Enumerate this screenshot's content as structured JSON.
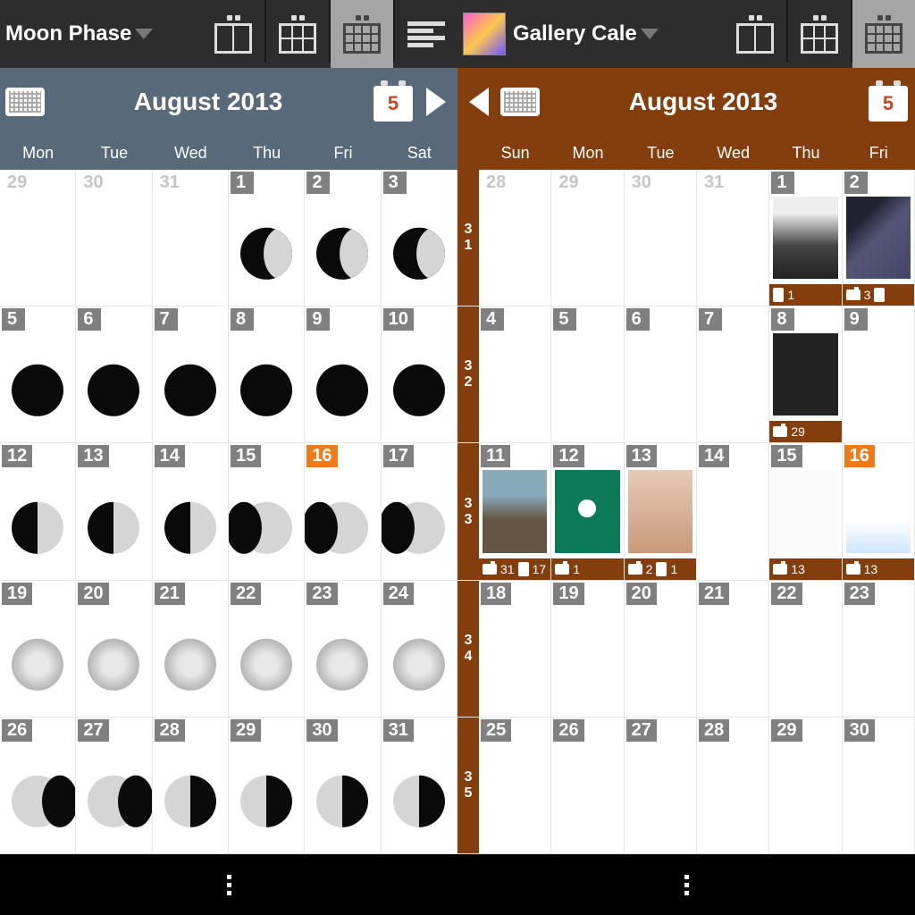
{
  "left": {
    "app_title": "Moon Phase",
    "month_title": "August 2013",
    "today_btn": "5",
    "daynames": [
      "Mon",
      "Tue",
      "Wed",
      "Thu",
      "Fri",
      "Sat"
    ],
    "weeks": [
      [
        {
          "n": "29",
          "o": 1
        },
        {
          "n": "30",
          "o": 1
        },
        {
          "n": "31",
          "o": 1
        },
        {
          "n": "1",
          "p": "wax-c"
        },
        {
          "n": "2",
          "p": "wax-c"
        },
        {
          "n": "3",
          "p": "wax-c"
        }
      ],
      [
        {
          "n": "5",
          "p": "new"
        },
        {
          "n": "6",
          "p": "new"
        },
        {
          "n": "7",
          "p": "new"
        },
        {
          "n": "8",
          "p": "new"
        },
        {
          "n": "9",
          "p": "new"
        },
        {
          "n": "10",
          "p": "new"
        }
      ],
      [
        {
          "n": "12",
          "p": "fq"
        },
        {
          "n": "13",
          "p": "fq"
        },
        {
          "n": "14",
          "p": "fq"
        },
        {
          "n": "15",
          "p": "wax-g"
        },
        {
          "n": "16",
          "p": "wax-g",
          "t": 1
        },
        {
          "n": "17",
          "p": "wax-g"
        }
      ],
      [
        {
          "n": "19",
          "p": "full"
        },
        {
          "n": "20",
          "p": "full"
        },
        {
          "n": "21",
          "p": "full"
        },
        {
          "n": "22",
          "p": "full"
        },
        {
          "n": "23",
          "p": "full"
        },
        {
          "n": "24",
          "p": "full"
        }
      ],
      [
        {
          "n": "26",
          "p": "wan-g"
        },
        {
          "n": "27",
          "p": "wan-g"
        },
        {
          "n": "28",
          "p": "lq"
        },
        {
          "n": "29",
          "p": "lq"
        },
        {
          "n": "30",
          "p": "lq"
        },
        {
          "n": "31",
          "p": "lq"
        }
      ]
    ]
  },
  "right": {
    "app_title": "Gallery Cale",
    "month_title": "August 2013",
    "today_btn": "5",
    "daynames": [
      "Sun",
      "Mon",
      "Tue",
      "Wed",
      "Thu",
      "Fri"
    ],
    "wknums": [
      "31",
      "32",
      "33",
      "34",
      "35"
    ],
    "weeks": [
      [
        {
          "n": "28",
          "o": 1
        },
        {
          "n": "29",
          "o": 1
        },
        {
          "n": "30",
          "o": 1
        },
        {
          "n": "31",
          "o": 1
        },
        {
          "n": "1",
          "th": "th1",
          "c": [
            {
              "i": "phone",
              "v": "1"
            }
          ]
        },
        {
          "n": "2",
          "th": "th2",
          "c": [
            {
              "i": "cam",
              "v": "3"
            },
            {
              "i": "phone",
              "v": ""
            }
          ]
        }
      ],
      [
        {
          "n": "4"
        },
        {
          "n": "5"
        },
        {
          "n": "6"
        },
        {
          "n": "7"
        },
        {
          "n": "8",
          "th": "th3",
          "c": [
            {
              "i": "cam",
              "v": "29"
            }
          ]
        },
        {
          "n": "9"
        }
      ],
      [
        {
          "n": "11",
          "th": "th4",
          "c": [
            {
              "i": "cam",
              "v": "31"
            },
            {
              "i": "phone",
              "v": "17"
            }
          ]
        },
        {
          "n": "12",
          "th": "th5",
          "c": [
            {
              "i": "cam",
              "v": "1"
            }
          ]
        },
        {
          "n": "13",
          "th": "th6",
          "c": [
            {
              "i": "cam",
              "v": "2"
            },
            {
              "i": "phone",
              "v": "1"
            }
          ]
        },
        {
          "n": "14"
        },
        {
          "n": "15",
          "th": "th7",
          "c": [
            {
              "i": "cam",
              "v": "13"
            }
          ]
        },
        {
          "n": "16",
          "t": 1,
          "th": "th8",
          "c": [
            {
              "i": "cam",
              "v": "13"
            }
          ]
        }
      ],
      [
        {
          "n": "18"
        },
        {
          "n": "19"
        },
        {
          "n": "20"
        },
        {
          "n": "21"
        },
        {
          "n": "22"
        },
        {
          "n": "23"
        }
      ],
      [
        {
          "n": "25"
        },
        {
          "n": "26"
        },
        {
          "n": "27"
        },
        {
          "n": "28"
        },
        {
          "n": "29"
        },
        {
          "n": "30"
        }
      ]
    ]
  }
}
